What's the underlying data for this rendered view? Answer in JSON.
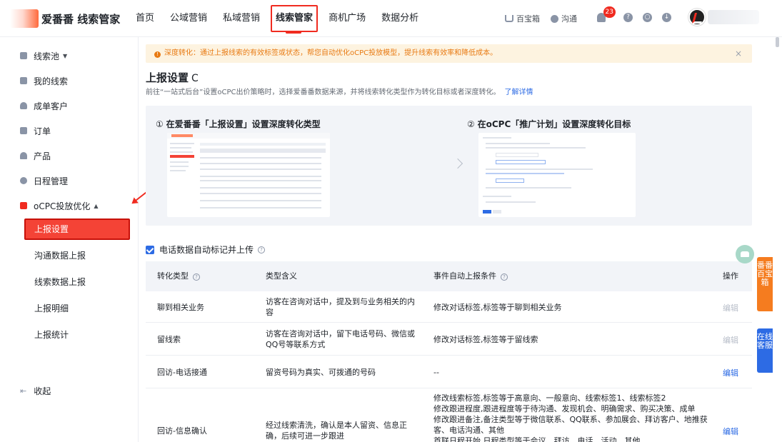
{
  "brand": {
    "name": "爱番番 线索管家"
  },
  "nav": {
    "items": [
      "首页",
      "公域营销",
      "私域营销",
      "线索管家",
      "商机广场",
      "数据分析"
    ],
    "active_index": 3
  },
  "top_right": {
    "treasure": "百宝箱",
    "chat": "沟通",
    "notifications": "23"
  },
  "sidebar": {
    "groups": [
      "线索池",
      "我的线索",
      "成单客户",
      "订单",
      "产品",
      "日程管理",
      "oCPC投放优化"
    ],
    "sub_items": [
      "上报设置",
      "沟通数据上报",
      "线索数据上报",
      "上报明细",
      "上报统计"
    ],
    "active_sub": "上报设置",
    "collapse": "收起"
  },
  "notice": {
    "text": "深度转化：通过上报线索的有效标签或状态，帮您自动优化oCPC投放模型，提升线索有效率和降低成本。",
    "close": "×"
  },
  "page": {
    "title": "上报设置",
    "refresh_glyph": "C",
    "description": "前往“一站式后台”设置oCPC出价策略时，选择爱番番数据来源，并将线索转化类型作为转化目标或者深度转化。",
    "link": "了解详情"
  },
  "steps": {
    "step1_num": "①",
    "step1_text": "在爱番番「上报设置」设置深度转化类型",
    "step2_num": "②",
    "step2_text": "在oCPC「推广计划」设置深度转化目标"
  },
  "checkbox": {
    "label": "电话数据自动标记并上传",
    "checked": true
  },
  "table": {
    "headers": [
      "转化类型",
      "类型含义",
      "事件自动上报条件",
      "操作"
    ],
    "rows": [
      {
        "type": "聊到相关业务",
        "meaning": "访客在咨询对话中，提及到与业务相关的内容",
        "condition": "修改对话标签,标签等于聊到相关业务",
        "action": "编辑",
        "enabled": false
      },
      {
        "type": "留线索",
        "meaning": "访客在咨询对话中，留下电话号码、微信或QQ号等联系方式",
        "condition": "修改对话标签,标签等于留线索",
        "action": "编辑",
        "enabled": false
      },
      {
        "type": "回访-电话接通",
        "meaning": "留资号码为真实、可拨通的号码",
        "condition": "--",
        "action": "编辑",
        "enabled": true
      },
      {
        "type": "回访-信息确认",
        "meaning": "经过线索清洗，确认是本人留资、信息正确，后续可进一步跟进",
        "condition": "修改线索标签,标签等于高意向、一般意向、线索标签1、线索标签2\n修改跟进程度,跟进程度等于待沟通、发现机会、明确需求、购买决策、成单\n修改跟进备注,备注类型等于微信联系、QQ联系、参加展会、拜访客户、地推获客、电话沟通、其他\n首联日程开始,日程类型等于会议、拜访、电话、活动、其他",
        "action": "编辑",
        "enabled": true
      }
    ]
  },
  "float_tabs": {
    "treasure_tab": "番番百宝箱",
    "service_tab": "在线客服"
  },
  "colors": {
    "brand_red": "#f02b20",
    "link_blue": "#2d6be4",
    "notice_orange": "#e87a12"
  }
}
